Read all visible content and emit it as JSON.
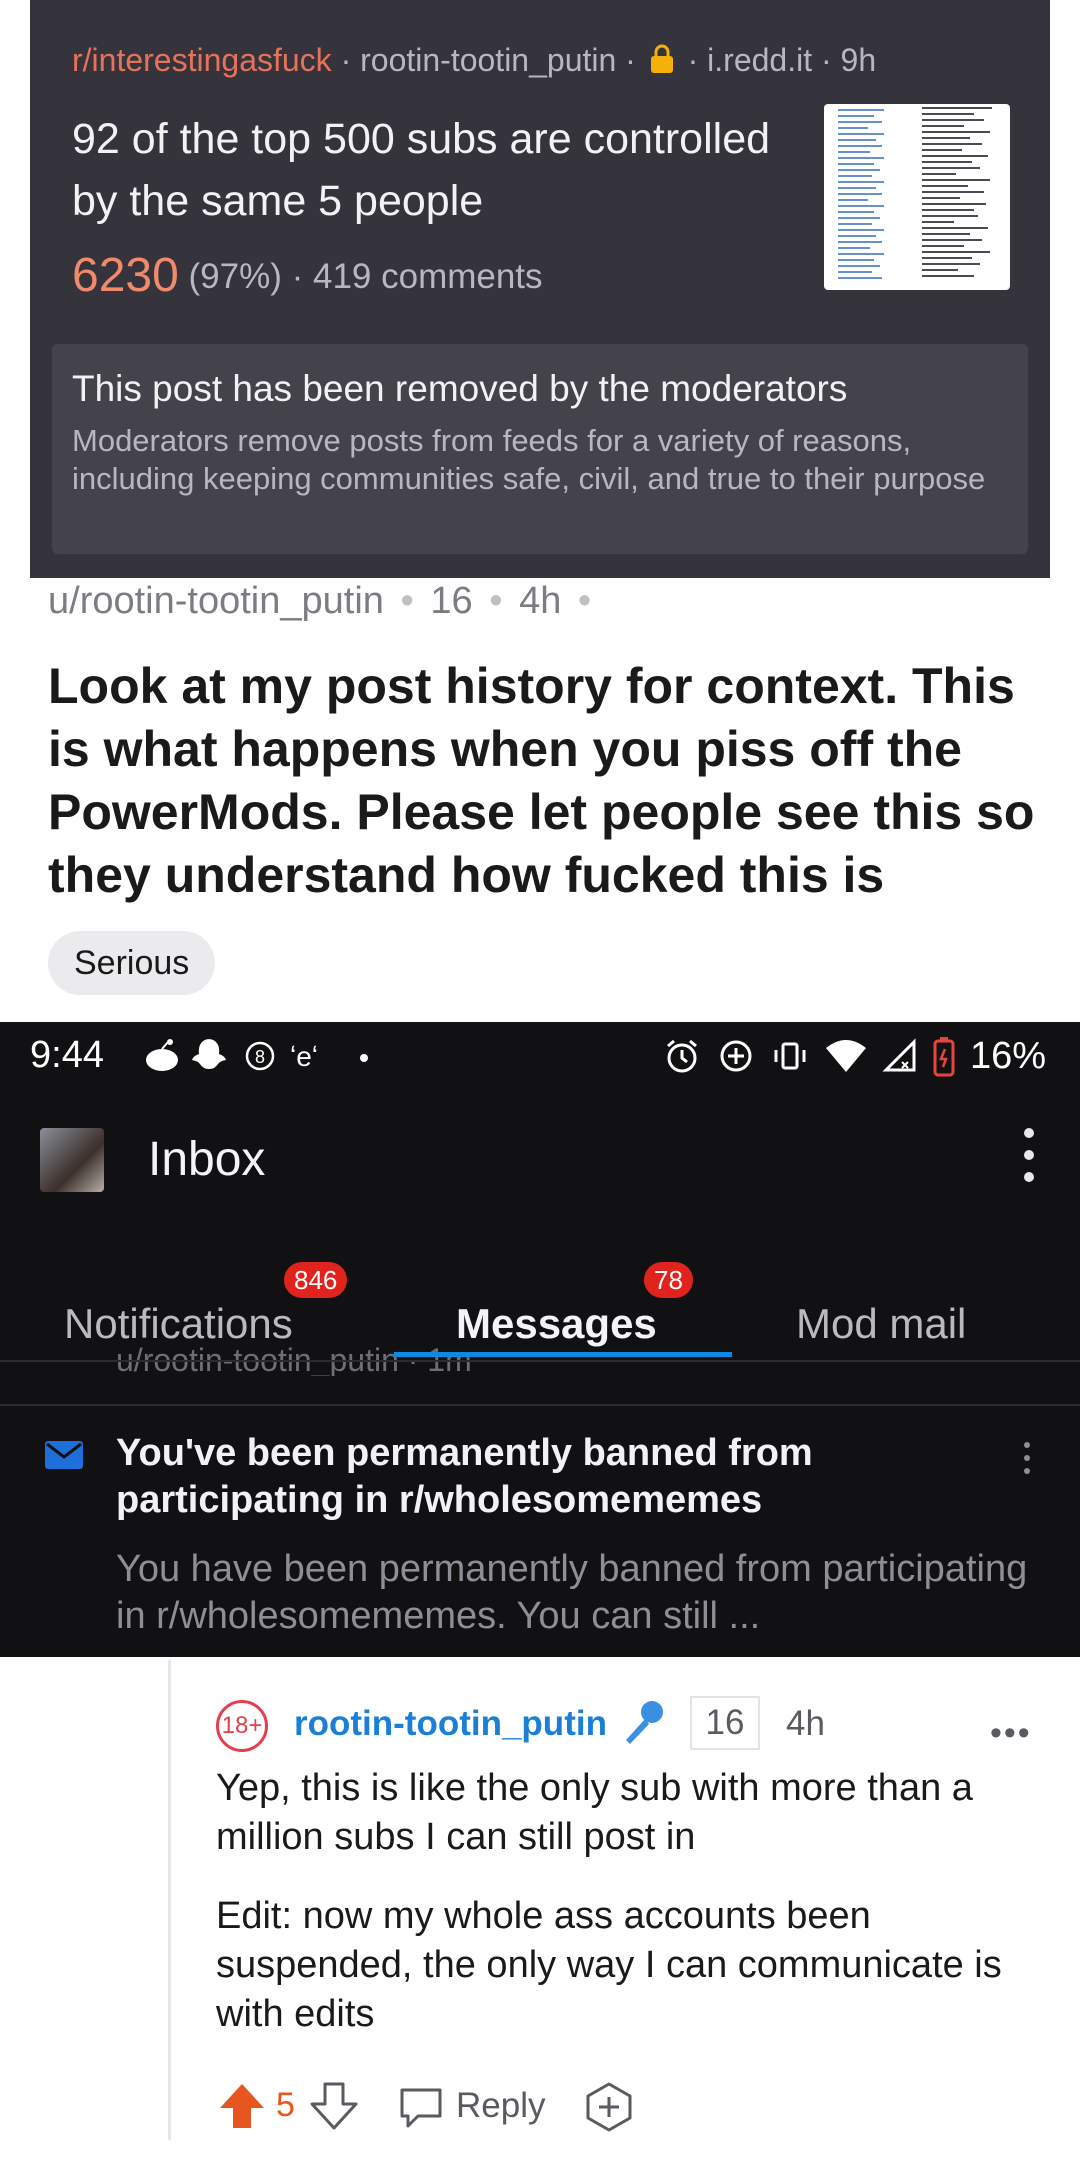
{
  "removed_post": {
    "subreddit": "r/interestingasfuck",
    "meta_rest": "· rootin-tootin_putin · ",
    "domain_time": "· i.redd.it · 9h",
    "title": "92 of the top 500 subs are controlled by the same 5 people",
    "score": "6230",
    "score_rest": "(97%) · 419 comments",
    "removed_title": "This post has been removed by the moderators",
    "removed_desc": "Moderators remove posts from feeds for a variety of reasons, including keeping communities safe, civil, and true to their purpose"
  },
  "post": {
    "author": "u/rootin-tootin_putin",
    "score": "16",
    "time": "4h",
    "title": "Look at my post history for context. This is what happens when you piss off the PowerMods. Please let people see this so they understand how fucked this is",
    "flair": "Serious"
  },
  "status_bar": {
    "time": "9:44",
    "battery": "16%"
  },
  "inbox": {
    "title": "Inbox",
    "tabs": [
      {
        "label": "Notifications",
        "badge": "846"
      },
      {
        "label": "Messages",
        "badge": "78"
      },
      {
        "label": "Mod mail"
      }
    ],
    "cut_row": "u/rootin-tootin_putin · 1m",
    "message": {
      "title": "You've been permanently banned from participating in r/wholesomememes",
      "body": "You have been permanently banned from participating in r/wholesomememes. You can still ..."
    }
  },
  "comment": {
    "nsfw": "18+",
    "author": "rootin-tootin_putin",
    "score": "16",
    "time": "4h",
    "more": "•••",
    "body": [
      "Yep, this is like the only sub with more than a million subs I can still post in",
      "Edit: now my whole ass accounts been suspended, the only way I can communicate is with edits"
    ],
    "votes": "5",
    "reply_label": "Reply"
  },
  "colors": {
    "upvote": "#e8561f",
    "link_blue": "#1b7fd6",
    "badge_red": "#e0231d",
    "tab_underline": "#0a8ae5"
  }
}
